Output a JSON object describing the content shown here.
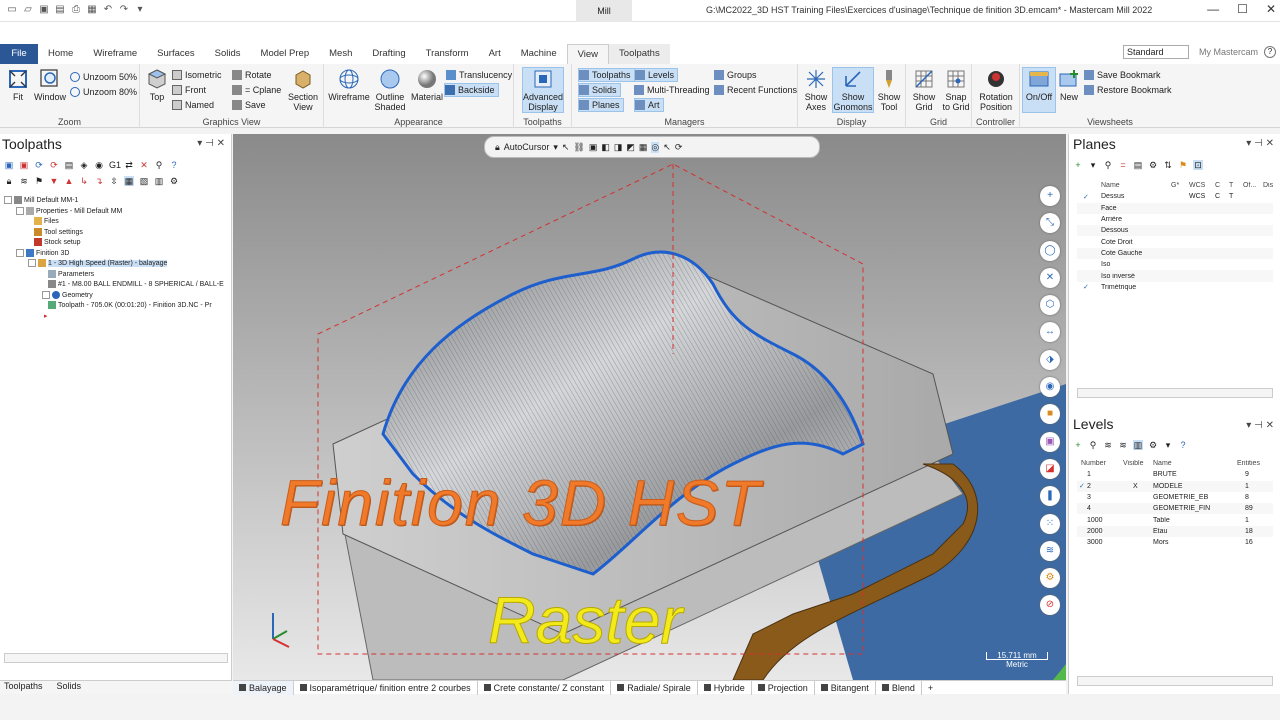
{
  "titlebar": {
    "path": "G:\\MC2022_3D HST Training Files\\Exercices d'usinage\\Technique de finition 3D.emcam* - Mastercam Mill 2022",
    "context": "Mill"
  },
  "tabs": [
    "File",
    "Home",
    "Wireframe",
    "Surfaces",
    "Solids",
    "Model Prep",
    "Mesh",
    "Drafting",
    "Transform",
    "Art",
    "Machine",
    "View",
    "Toolpaths"
  ],
  "workspace": "Standard",
  "my_mastercam": "My Mastercam",
  "ribbon": {
    "zoom": {
      "fit": "Fit",
      "window": "Window",
      "unzoom50": "Unzoom 50%",
      "unzoom80": "Unzoom 80%",
      "label": "Zoom"
    },
    "gview": {
      "top": "Top",
      "isometric": "Isometric",
      "front": "Front",
      "named": "Named",
      "rotate": "Rotate",
      "cplane": "= Cplane",
      "save": "Save",
      "section": "Section",
      "view": "View",
      "label": "Graphics View"
    },
    "appearance": {
      "wireframe": "Wireframe",
      "outline": "Outline",
      "shaded": "Shaded",
      "material": "Material",
      "translucency": "Translucency",
      "backside": "Backside",
      "label": "Appearance"
    },
    "toolpaths": {
      "advanced": "Advanced",
      "display": "Display",
      "label": "Toolpaths"
    },
    "managers": {
      "toolpaths": "Toolpaths",
      "solids": "Solids",
      "planes": "Planes",
      "levels": "Levels",
      "multithreading": "Multi-Threading",
      "art": "Art",
      "groups": "Groups",
      "recent": "Recent Functions",
      "label": "Managers"
    },
    "display": {
      "showaxes": "Show",
      "axes": "Axes",
      "showgnomons": "Show",
      "gnomons": "Gnomons",
      "showtool": "Show",
      "tool": "Tool",
      "label": "Display"
    },
    "grid": {
      "showgrid": "Show",
      "grid": "Grid",
      "snap": "Snap",
      "togrid": "to Grid",
      "label": "Grid"
    },
    "controller": {
      "rotation": "Rotation",
      "position": "Position",
      "label": "Controller"
    },
    "onoff": {
      "onoff": "On/Off",
      "new": "New"
    },
    "viewsheets": {
      "savebm": "Save Bookmark",
      "restorebm": "Restore Bookmark",
      "label": "Viewsheets"
    }
  },
  "left": {
    "title": "Toolpaths",
    "tree": [
      "Mill Default MM-1",
      "Properties - Mill Default MM",
      "Files",
      "Tool settings",
      "Stock setup",
      "Finition 3D",
      "1 - 3D High Speed (Raster) - balayage",
      "Parameters",
      "#1 - M8.00 BALL ENDMILL - 8 SPHERICAL / BALL-E",
      "Geometry",
      "Toolpath - 705.0K (00:01:20) - Finition 3D.NC - Pr"
    ],
    "bottom": [
      "Toolpaths",
      "Solids"
    ]
  },
  "viewport": {
    "autocursor": "AutoCursor",
    "overlay1": "Finition 3D HST",
    "overlay2": "Raster",
    "scale_value": "15.711 mm",
    "scale_unit": "Metric"
  },
  "planes": {
    "title": "Planes",
    "headers": [
      "Name",
      "G*",
      "WCS",
      "C",
      "T",
      "Of...",
      "Dis"
    ],
    "rows": [
      {
        "check": "✓",
        "name": "Dessus",
        "wcs": "WCS",
        "c": "C",
        "t": "T"
      },
      {
        "check": "",
        "name": "Face",
        "wcs": "",
        "c": "",
        "t": ""
      },
      {
        "check": "",
        "name": "Arrière",
        "wcs": "",
        "c": "",
        "t": ""
      },
      {
        "check": "",
        "name": "Dessous",
        "wcs": "",
        "c": "",
        "t": ""
      },
      {
        "check": "",
        "name": "Cote Droit",
        "wcs": "",
        "c": "",
        "t": ""
      },
      {
        "check": "",
        "name": "Cote Gauche",
        "wcs": "",
        "c": "",
        "t": ""
      },
      {
        "check": "",
        "name": "Iso",
        "wcs": "",
        "c": "",
        "t": ""
      },
      {
        "check": "",
        "name": "Iso inversé",
        "wcs": "",
        "c": "",
        "t": ""
      },
      {
        "check": "✓",
        "name": "Trimétrique",
        "wcs": "",
        "c": "",
        "t": ""
      }
    ]
  },
  "levels": {
    "title": "Levels",
    "headers": [
      "Number",
      "Visible",
      "Name",
      "Entities"
    ],
    "rows": [
      {
        "check": "",
        "num": "1",
        "vis": "",
        "name": "BRUTE",
        "ent": "9"
      },
      {
        "check": "✓",
        "num": "2",
        "vis": "X",
        "name": "MODELE",
        "ent": "1"
      },
      {
        "check": "",
        "num": "3",
        "vis": "",
        "name": "GEOMETRIE_EB",
        "ent": "8"
      },
      {
        "check": "",
        "num": "4",
        "vis": "",
        "name": "GEOMETRIE_FIN",
        "ent": "89"
      },
      {
        "check": "",
        "num": "1000",
        "vis": "",
        "name": "Table",
        "ent": "1"
      },
      {
        "check": "",
        "num": "2000",
        "vis": "",
        "name": "Etau",
        "ent": "18"
      },
      {
        "check": "",
        "num": "3000",
        "vis": "",
        "name": "Mors",
        "ent": "16"
      }
    ]
  },
  "statusbar": [
    "Balayage",
    "Isoparamétrique/ finition entre 2 courbes",
    "Crete constante/ Z constant",
    "Radiale/ Spirale",
    "Hybride",
    "Projection",
    "Bitangent",
    "Blend",
    "+"
  ],
  "colors": {
    "accent": "#2b5797",
    "overlay1": "#f07a2a",
    "overlay2": "#f2ea1b"
  }
}
